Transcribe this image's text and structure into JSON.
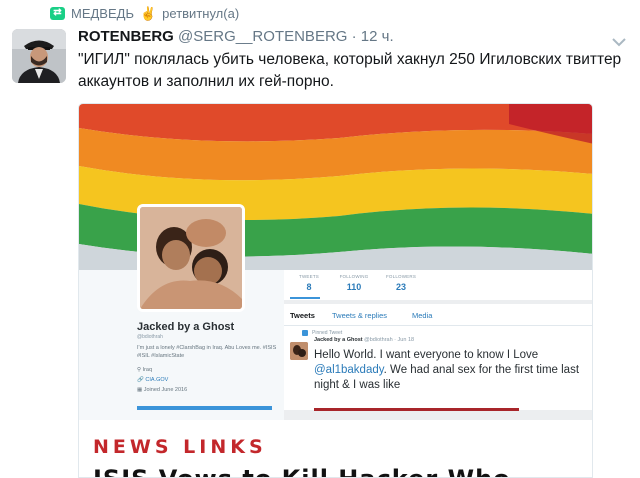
{
  "retweet": {
    "user": "МЕДВЕДЬ",
    "hand": "✌",
    "action": "ретвитнул(а)",
    "icon": "retweet-icon"
  },
  "tweet": {
    "author": "ROTENBERG",
    "handle": "@SERG__ROTENBERG",
    "separator": "·",
    "time": "12 ч.",
    "text": "\"ИГИЛ\" поклялась убить человека, который хакнул 250 Игиловских твиттер аккаунтов и заполнил их гей-порно."
  },
  "media": {
    "profile": {
      "name": "Jacked by a Ghost",
      "handle": "@bdiothrah",
      "bio": "I'm just a lonely #ClarshBag in Iraq. Abu Loves me. #ISIS #ISIL #IslamicState",
      "location": "Iraq",
      "link": "CIA.GOV",
      "joined": "Joined June 2016"
    },
    "stats": [
      {
        "label": "TWEETS",
        "value": "8"
      },
      {
        "label": "FOLLOWING",
        "value": "110"
      },
      {
        "label": "FOLLOWERS",
        "value": "23"
      }
    ],
    "tabs": [
      "Tweets",
      "Tweets & replies",
      "Media"
    ],
    "pinned_label": "Pinned Tweet",
    "pinned_tweet": {
      "name": "Jacked by a Ghost",
      "meta": "@bdiothrah · Jun 18",
      "text_before": "Hello World. I want everyone to know I Love ",
      "mention": "@al1bakdady",
      "text_after": ". We had anal sex for the first time last night & I was like"
    },
    "news_title": "NEWS LINKS",
    "news_headline": "ISIS Vows to Kill Hacker Who"
  },
  "colors": {
    "accent": "#1da1f2",
    "retweet_green": "#19cf86",
    "news_red": "#c3272b",
    "muted": "#657786"
  }
}
